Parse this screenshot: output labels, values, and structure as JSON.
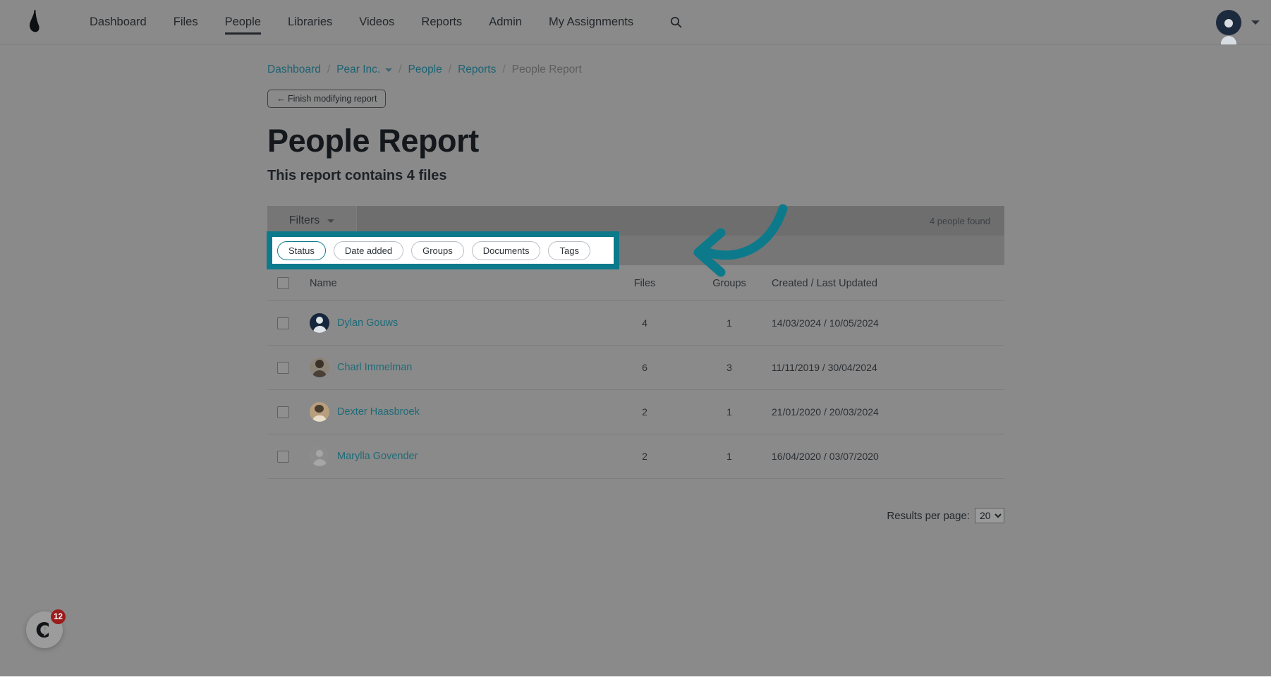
{
  "nav": {
    "logo_icon": "pear-logo-icon",
    "links": [
      {
        "label": "Dashboard",
        "active": false
      },
      {
        "label": "Files",
        "active": false
      },
      {
        "label": "People",
        "active": true
      },
      {
        "label": "Libraries",
        "active": false
      },
      {
        "label": "Videos",
        "active": false
      },
      {
        "label": "Reports",
        "active": false
      },
      {
        "label": "Admin",
        "active": false
      },
      {
        "label": "My Assignments",
        "active": false
      }
    ],
    "search_icon": "search-icon",
    "account_icon": "user-avatar-icon",
    "account_chevron": "chevron-down-icon"
  },
  "breadcrumb": {
    "items": [
      {
        "label": "Dashboard",
        "type": "link"
      },
      {
        "label": "Pear Inc.",
        "type": "link-with-chevron"
      },
      {
        "label": "People",
        "type": "link"
      },
      {
        "label": "Reports",
        "type": "link"
      },
      {
        "label": "People Report",
        "type": "current"
      }
    ],
    "separator": "/"
  },
  "actions": {
    "finish_modifying_label": "← Finish modifying report"
  },
  "header": {
    "title": "People Report",
    "subtitle": "This report contains 4 files"
  },
  "filterbar": {
    "filters_label": "Filters",
    "filters_chevron_icon": "chevron-down-icon",
    "results_count": "4 people found"
  },
  "filter_chips": [
    {
      "label": "Status",
      "selected": true
    },
    {
      "label": "Date added",
      "selected": false
    },
    {
      "label": "Groups",
      "selected": false
    },
    {
      "label": "Documents",
      "selected": false
    },
    {
      "label": "Tags",
      "selected": false
    }
  ],
  "annotation": {
    "highlight_color": "#0d7a8c",
    "arrow_color": "#0d7a8c",
    "arrow_direction": "left"
  },
  "table": {
    "columns": [
      "Name",
      "Files",
      "Groups",
      "Created / Last Updated"
    ],
    "select_all_checkbox": "unchecked",
    "rows": [
      {
        "name": "Dylan Gouws",
        "files": "4",
        "groups": "1",
        "dates": "14/03/2024 / 10/05/2024",
        "avatar": "avatar-dylan",
        "checked": false
      },
      {
        "name": "Charl Immelman",
        "files": "6",
        "groups": "3",
        "dates": "11/11/2019 / 30/04/2024",
        "avatar": "avatar-charl",
        "checked": false
      },
      {
        "name": "Dexter Haasbroek",
        "files": "2",
        "groups": "1",
        "dates": "21/01/2020 / 20/03/2024",
        "avatar": "avatar-dexter",
        "checked": false
      },
      {
        "name": "Marylla Govender",
        "files": "2",
        "groups": "1",
        "dates": "16/04/2020 / 03/07/2020",
        "avatar": "avatar-marylla",
        "checked": false
      }
    ]
  },
  "footer": {
    "results_per_page_label": "Results per page:",
    "results_per_page_value": "20",
    "results_per_page_options": [
      "20"
    ]
  },
  "fab": {
    "icon": "chat-widget-icon",
    "badge_count": "12",
    "badge_color": "#9b1c1c"
  }
}
